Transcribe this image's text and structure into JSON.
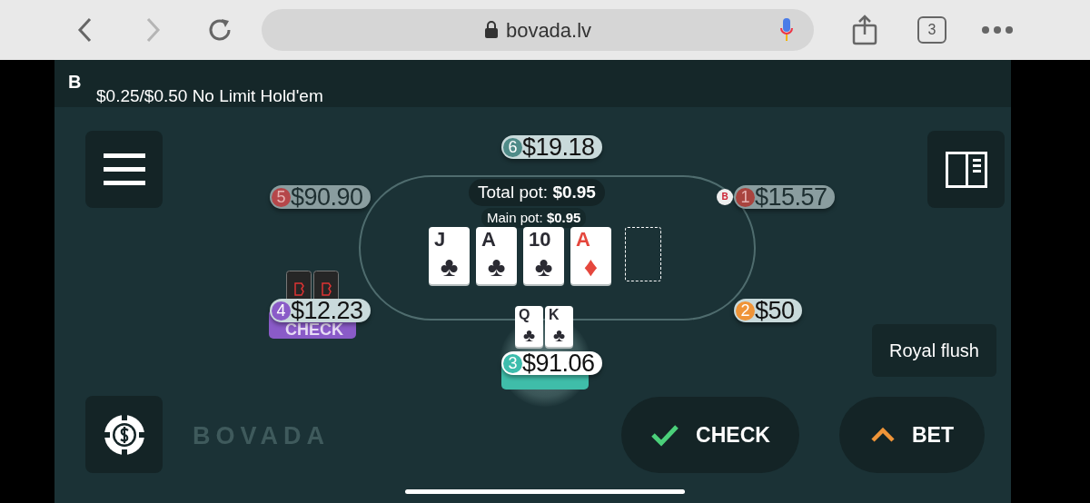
{
  "browser": {
    "url": "bovada.lv",
    "tab_count": "3",
    "forward_disabled": true
  },
  "header": {
    "logo": "B",
    "title": "$0.25/$0.50 No Limit Hold'em"
  },
  "pot": {
    "total_label": "Total pot:",
    "total": "$0.95",
    "main_label": "Main pot:",
    "main": "$0.95"
  },
  "board": [
    {
      "kind": "card",
      "rank": "J",
      "suit": "♣",
      "color": "#2b2b33"
    },
    {
      "kind": "card",
      "rank": "A",
      "suit": "♣",
      "color": "#2b2b33"
    },
    {
      "kind": "card",
      "rank": "10",
      "suit": "♣",
      "color": "#2b2b33"
    },
    {
      "kind": "card",
      "rank": "A",
      "suit": "♦",
      "color": "#e5473d"
    },
    {
      "kind": "empty"
    }
  ],
  "seats": [
    {
      "number": "6",
      "stack": "$19.18",
      "color": "#4f8b88",
      "folded": false
    },
    {
      "number": "5",
      "stack": "$90.90",
      "color": "#b5474a",
      "folded": true
    },
    {
      "number": "1",
      "stack": "$15.57",
      "color": "#a9443f",
      "folded": true,
      "dealer": true
    },
    {
      "number": "4",
      "stack": "$12.23",
      "color": "#8a5bc8",
      "folded": false,
      "action": "CHECK",
      "cards_hidden": true
    },
    {
      "number": "2",
      "stack": "$50",
      "color": "#ef9438",
      "folded": false
    },
    {
      "number": "3",
      "stack": "$91.06",
      "color": "#3dbdad",
      "folded": false,
      "hero": true,
      "hole_cards": [
        {
          "rank": "Q",
          "suit": "♣",
          "color": "#2b2b33"
        },
        {
          "rank": "K",
          "suit": "♣",
          "color": "#2b2b33"
        }
      ]
    }
  ],
  "dealer_button": {
    "label": "B"
  },
  "hand_strength": "Royal flush",
  "brand": "BOVADA",
  "actions": [
    {
      "kind": "check",
      "label": "CHECK"
    },
    {
      "kind": "bet",
      "label": "BET"
    }
  ]
}
